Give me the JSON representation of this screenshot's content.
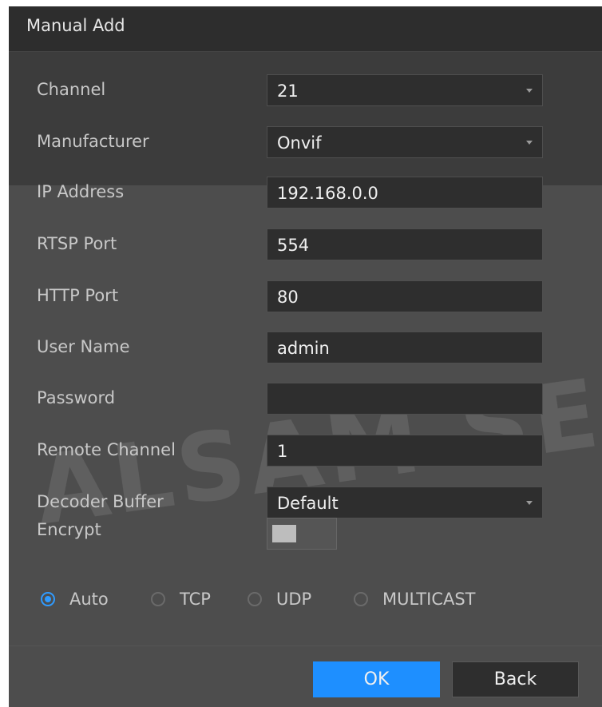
{
  "dialog": {
    "title": "Manual Add"
  },
  "fields": {
    "channel": {
      "label": "Channel",
      "value": "21"
    },
    "manufacturer": {
      "label": "Manufacturer",
      "value": "Onvif"
    },
    "ip_address": {
      "label": "IP Address",
      "value": "192.168.0.0"
    },
    "rtsp_port": {
      "label": "RTSP Port",
      "value": "554"
    },
    "http_port": {
      "label": "HTTP Port",
      "value": "80"
    },
    "user_name": {
      "label": "User Name",
      "value": "admin"
    },
    "password": {
      "label": "Password",
      "value": ""
    },
    "remote_channel": {
      "label": "Remote Channel",
      "value": "1"
    },
    "decoder_buffer": {
      "label": "Decoder Buffer",
      "value": "Default"
    },
    "encrypt": {
      "label": "Encrypt",
      "enabled": false
    }
  },
  "protocol": {
    "options": [
      "Auto",
      "TCP",
      "UDP",
      "MULTICAST"
    ],
    "selected": "Auto"
  },
  "footer": {
    "ok_label": "OK",
    "back_label": "Back"
  },
  "watermark": {
    "text": "ALSAM SECU"
  },
  "colors": {
    "accent": "#1e8fff",
    "panel": "#3c3c3c",
    "titlebar": "#2d2d2d"
  }
}
